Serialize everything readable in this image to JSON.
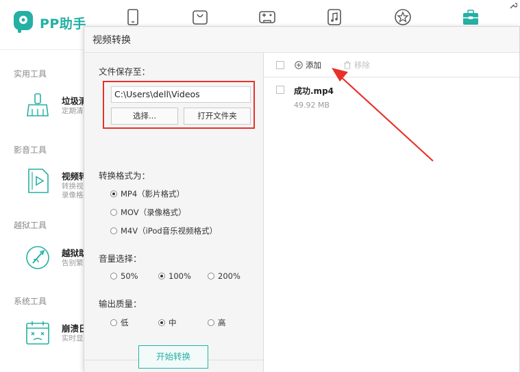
{
  "app": {
    "name": "PP助手",
    "brand_color": "#24b0a4",
    "logo_icon": "pp-logo-icon"
  },
  "top_nav": {
    "icons": [
      "phone-icon",
      "bag-icon",
      "game-icon",
      "music-icon",
      "star-icon",
      "toolbox-icon"
    ],
    "corner_icon": "settings-wrench-icon"
  },
  "sidebar": {
    "sections": [
      {
        "title": "实用工具",
        "tool": {
          "name": "垃圾清",
          "desc": "定期清",
          "icon": "broom-icon"
        }
      },
      {
        "title": "影音工具",
        "tool": {
          "name": "视频转",
          "desc": "转换视录像格",
          "icon": "video-file-icon"
        }
      },
      {
        "title": "越狱工具",
        "tool": {
          "name": "越狱助",
          "desc": "告别繁",
          "icon": "jailbreak-icon"
        }
      },
      {
        "title": "系统工具",
        "tool": {
          "name": "崩溃日",
          "desc": "实时显",
          "icon": "crash-log-icon"
        }
      }
    ]
  },
  "dialog": {
    "title": "视频转换",
    "save_label": "文件保存至：",
    "save_path": "C:\\Users\\dell\\Videos",
    "choose_button": "选择...",
    "open_folder_button": "打开文件夹",
    "format_label": "转换格式为：",
    "formats": [
      {
        "label": "MP4（影片格式）",
        "selected": true
      },
      {
        "label": "MOV（录像格式）",
        "selected": false
      },
      {
        "label": "M4V（iPod音乐视频格式）",
        "selected": false
      }
    ],
    "volume_label": "音量选择：",
    "volumes": [
      {
        "label": "50%",
        "selected": false
      },
      {
        "label": "100%",
        "selected": true
      },
      {
        "label": "200%",
        "selected": false
      }
    ],
    "quality_label": "输出质量：",
    "qualities": [
      {
        "label": "低",
        "selected": false
      },
      {
        "label": "中",
        "selected": true
      },
      {
        "label": "高",
        "selected": false
      }
    ],
    "start_button": "开始转换",
    "toolbar": {
      "add_label": "添加",
      "remove_label": "移除"
    },
    "files": [
      {
        "name": "成功.mp4",
        "size": "49.92 MB"
      }
    ]
  }
}
